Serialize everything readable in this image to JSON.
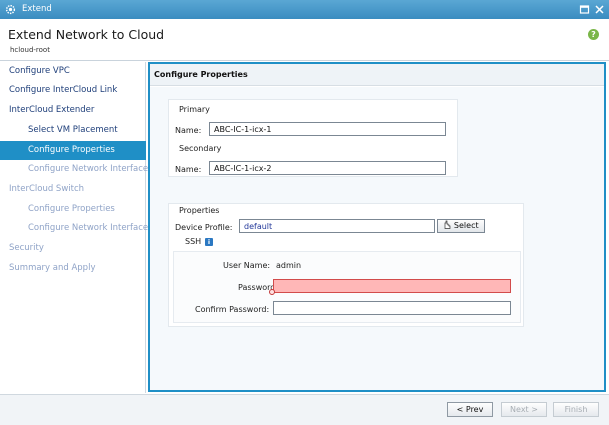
{
  "window": {
    "title": "Extend",
    "app_icon": "gear-icon",
    "controls": [
      "maximize-icon",
      "close-icon"
    ]
  },
  "header": {
    "title": "Extend Network to Cloud",
    "subtitle": "hcloud-root",
    "help_icon": "help-icon",
    "help_glyph": "?"
  },
  "sidebar": {
    "items": [
      {
        "label": "Configure VPC",
        "state": "normal"
      },
      {
        "label": "Configure InterCloud Link",
        "state": "normal"
      },
      {
        "label": "InterCloud Extender",
        "state": "normal"
      },
      {
        "label": "Select VM Placement",
        "state": "normal"
      },
      {
        "label": "Configure Properties",
        "state": "active"
      },
      {
        "label": "Configure Network Interfaces",
        "state": "disabled"
      },
      {
        "label": "InterCloud Switch",
        "state": "disabled"
      },
      {
        "label": "Configure Properties",
        "state": "disabled"
      },
      {
        "label": "Configure Network Interfaces",
        "state": "disabled"
      },
      {
        "label": "Security",
        "state": "disabled"
      },
      {
        "label": "Summary and Apply",
        "state": "disabled"
      }
    ]
  },
  "content": {
    "header": "Configure Properties",
    "primary": {
      "heading": "Primary",
      "name_label": "Name:",
      "name_value": "ABC-IC-1-icx-1"
    },
    "secondary": {
      "heading": "Secondary",
      "name_label": "Name:",
      "name_value": "ABC-IC-1-icx-2"
    },
    "properties": {
      "heading": "Properties",
      "device_profile_label": "Device Profile:",
      "device_profile_value": "default",
      "select_button": "Select",
      "select_icon": "hand-pointer-icon",
      "ssh": {
        "heading": "SSH",
        "info_icon": "info-icon",
        "user_name_label": "User Name:",
        "user_name_value": "admin",
        "password_label": "Password:",
        "password_value": "",
        "password_state": "error",
        "confirm_password_label": "Confirm Password:",
        "confirm_password_value": ""
      }
    }
  },
  "footer": {
    "prev": "< Prev",
    "next": "Next >",
    "finish": "Finish"
  },
  "colors": {
    "accent": "#1f8fc6",
    "title_bar": "#3a8cc0",
    "error_fill": "#ffb7b7",
    "disabled_text": "#8fa3c7",
    "nav_text": "#1f3f7a"
  }
}
